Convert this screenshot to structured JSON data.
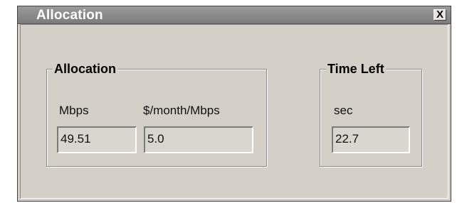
{
  "window": {
    "title": "Allocation",
    "close_glyph": "X",
    "close_icon": "close-icon"
  },
  "allocation_group": {
    "title": "Allocation",
    "mbps_label": "Mbps",
    "mbps_value": "49.51",
    "price_label": "$/month/Mbps",
    "price_value": "5.0"
  },
  "time_group": {
    "title": "Time Left",
    "sec_label": "sec",
    "sec_value": "22.7"
  }
}
